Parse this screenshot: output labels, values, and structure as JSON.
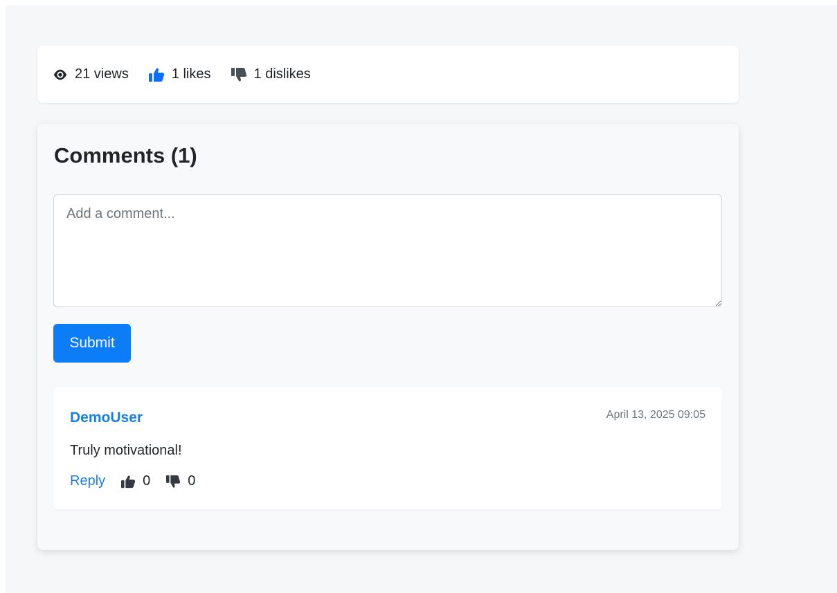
{
  "stats": {
    "views": "21 views",
    "likes": "1 likes",
    "dislikes": "1 dislikes",
    "icons": {
      "views": "eye-icon",
      "likes": "thumbs-up-icon",
      "dislikes": "thumbs-down-icon"
    },
    "colors": {
      "like_active": "#0d6efd",
      "default_icon": "#212529",
      "dislike_icon": "#495057"
    }
  },
  "comments": {
    "title": "Comments (1)",
    "input_placeholder": "Add a comment...",
    "input_value": "",
    "submit_label": "Submit",
    "items": [
      {
        "author": "DemoUser",
        "timestamp": "April 13, 2025 09:05",
        "text": "Truly motivational!",
        "reply_label": "Reply",
        "likes": "0",
        "dislikes": "0"
      }
    ]
  },
  "colors": {
    "primary": "#0d7df7",
    "link": "#1a7fe0",
    "muted": "#6c757d",
    "page_bg": "#f6f7f9"
  }
}
